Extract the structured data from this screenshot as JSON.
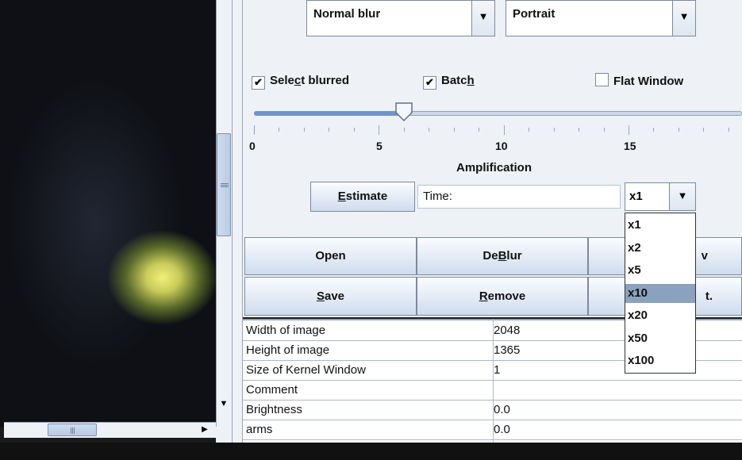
{
  "blur_type": {
    "selected": "Normal blur"
  },
  "orientation": {
    "selected": "Portrait"
  },
  "checkboxes": {
    "select_blurred": {
      "pre": "Sele",
      "mn": "c",
      "post": "t blurred",
      "checked": true,
      "mark": "✔"
    },
    "batch": {
      "pre": "Batc",
      "mn": "h",
      "post": "",
      "checked": true,
      "mark": "✔"
    },
    "flat_window": {
      "label": "Flat Window",
      "checked": false
    }
  },
  "slider": {
    "label": "Amplification",
    "value": 6,
    "min": 0,
    "max": 20,
    "ticks": [
      "0",
      "5",
      "10",
      "15"
    ]
  },
  "estimate_button": {
    "mn": "E",
    "rest": "stimate"
  },
  "time_field": {
    "value": "Time:"
  },
  "multiplier": {
    "selected": "x1",
    "options": [
      "x1",
      "x2",
      "x5",
      "x10",
      "x20",
      "x50",
      "x100"
    ],
    "highlighted": "x10"
  },
  "buttons": {
    "open": "Open",
    "deblur": {
      "pre": "De",
      "mn": "B",
      "post": "lur"
    },
    "view_partial": "v",
    "save": {
      "mn": "S",
      "rest": "ave"
    },
    "remove": {
      "mn": "R",
      "rest": "emove"
    },
    "trunc_partial": "t."
  },
  "properties": [
    {
      "name": "Width of image",
      "value": "2048"
    },
    {
      "name": "Height of image",
      "value": "1365"
    },
    {
      "name": "Size of Kernel Window",
      "value": "1"
    },
    {
      "name": "Comment",
      "value": ""
    },
    {
      "name": "Brightness",
      "value": "0.0"
    },
    {
      "name": "arms",
      "value": "0.0"
    }
  ],
  "icons": {
    "dropdown": "▼",
    "scroll_down": "▼",
    "scroll_right": "▶"
  },
  "colors": {
    "panel_bg": "#eef1f6",
    "accent": "#6f95c9",
    "selected_option": "#8aa2bd"
  }
}
